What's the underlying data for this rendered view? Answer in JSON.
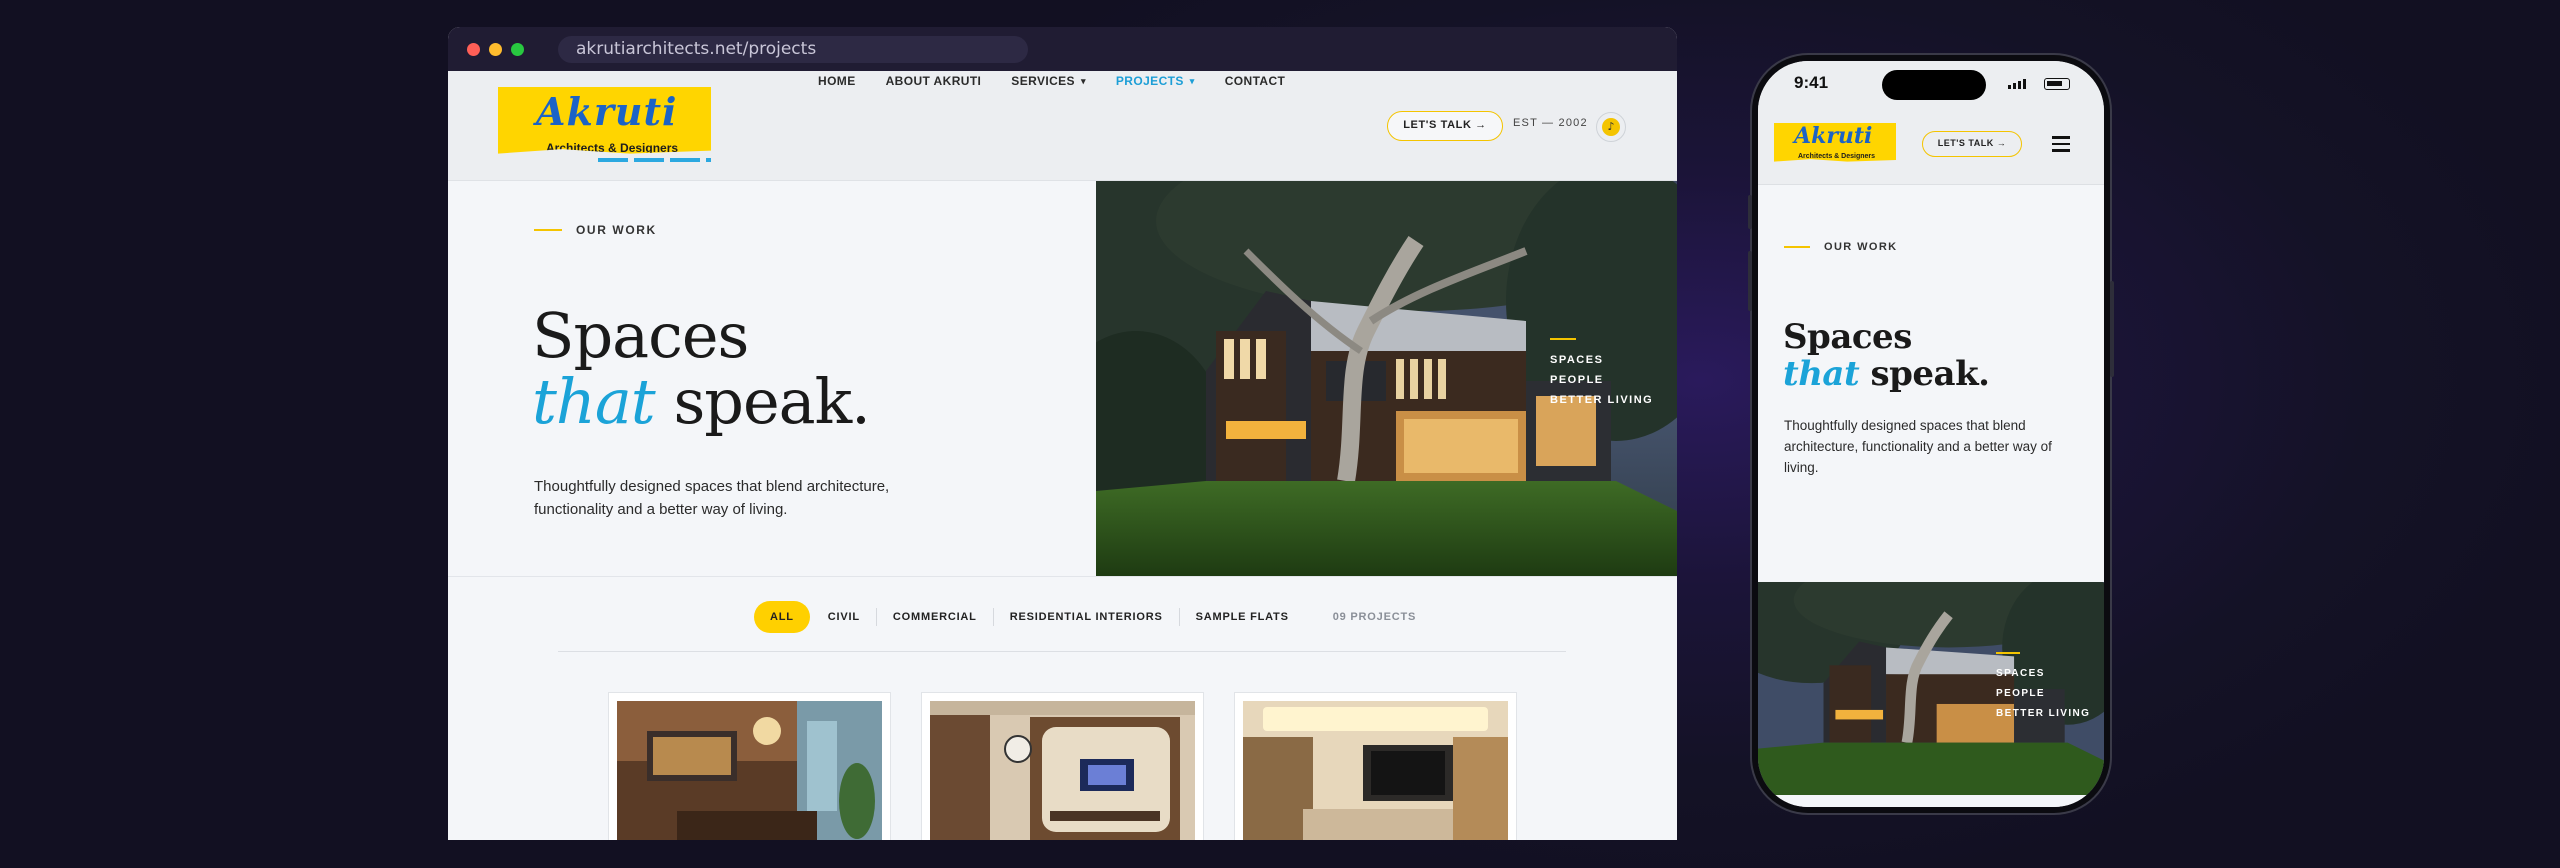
{
  "browser": {
    "url": "akrutiarchitects.net/projects"
  },
  "logo": {
    "name": "Akruti",
    "tagline": "Architects & Designers"
  },
  "nav": {
    "items": [
      {
        "label": "HOME",
        "has_caret": false,
        "active": false
      },
      {
        "label": "ABOUT AKRUTI",
        "has_caret": false,
        "active": false
      },
      {
        "label": "SERVICES",
        "has_caret": true,
        "active": false
      },
      {
        "label": "PROJECTS",
        "has_caret": true,
        "active": true
      },
      {
        "label": "CONTACT",
        "has_caret": false,
        "active": false
      }
    ],
    "caret_glyph": "▾"
  },
  "header": {
    "cta_label": "LET'S TALK →",
    "est_label": "EST — 2002",
    "badge_icon": "sun-icon"
  },
  "hero": {
    "eyebrow": "OUR WORK",
    "headline_line1": "Spaces",
    "headline_accent": "that",
    "headline_rest": " speak.",
    "subcopy": "Thoughtfully designed spaces that blend architecture, functionality and a better way of living.",
    "photo_labels": [
      "SPACES",
      "PEOPLE",
      "BETTER LIVING"
    ]
  },
  "filters": {
    "items": [
      {
        "label": "ALL",
        "active": true
      },
      {
        "label": "CIVIL",
        "active": false
      },
      {
        "label": "COMMERCIAL",
        "active": false
      },
      {
        "label": "RESIDENTIAL INTERIORS",
        "active": false
      },
      {
        "label": "SAMPLE FLATS",
        "active": false
      }
    ],
    "count_label": "09 PROJECTS"
  },
  "cards": [
    {
      "name": "dining-room-project"
    },
    {
      "name": "tv-lounge-project"
    },
    {
      "name": "living-room-project"
    }
  ],
  "phone": {
    "time": "9:41",
    "cta_label": "LET'S TALK →",
    "menu_icon": "hamburger-icon"
  },
  "colors": {
    "accent_yellow": "#ffd000",
    "accent_blue": "#1ba3d8",
    "logo_blue": "#1b63c6"
  }
}
